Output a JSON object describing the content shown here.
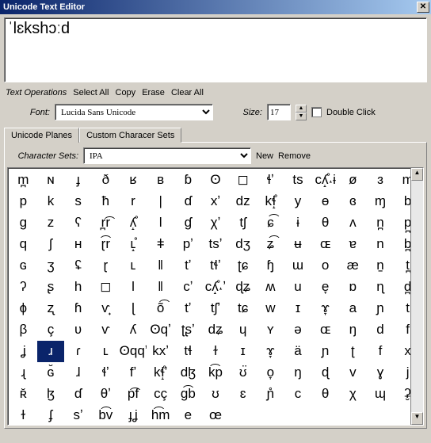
{
  "window": {
    "title": "Unicode Text Editor"
  },
  "editor": {
    "text": "ˈlɛkshɔːd"
  },
  "ops": {
    "label": "Text Operations",
    "select_all": "Select All",
    "copy": "Copy",
    "erase": "Erase",
    "clear_all": "Clear All"
  },
  "font": {
    "label": "Font:",
    "value": "Lucida Sans Unicode",
    "size_label": "Size:",
    "size_value": "17",
    "double_click": "Double Click"
  },
  "tabs": {
    "planes": "Unicode Planes",
    "custom": "Custom Characer Sets"
  },
  "charset": {
    "label": "Character Sets:",
    "value": "IPA",
    "new": "New",
    "remove": "Remove"
  },
  "grid": {
    "selected_index": 121,
    "cells": [
      "m̪",
      "ɴ",
      "ɟ",
      "ð",
      "ʁ",
      "ʙ",
      "ɓ",
      "ʘ",
      "◻",
      "ɬʼ",
      "ts",
      "cʎ̝̊˔ɨ",
      "ø",
      "ɜ",
      "m",
      "p",
      "k",
      "s",
      "ħ",
      "r",
      "|",
      "ɗ",
      "xʼ",
      "dz",
      "kɬ̝̊",
      "y",
      "ɵ",
      "ɞ",
      "ɱ",
      "b",
      "g",
      "z",
      "ʕ",
      "r̪͡r",
      "ʎ̝̊",
      "ǀ",
      "ɠ",
      "χʼ",
      "tʃ",
      "ɕ͡",
      "ɨ",
      "θ",
      "ʌ",
      "n̪",
      "p̪",
      "q",
      "ʃ",
      "ʜ",
      "ɽ͡r",
      "ʟ̝̊",
      "ǂ",
      "pʼ",
      "tsʼ",
      "dʒ",
      "ʑ͡",
      "ʉ",
      "ɶ",
      "ɐ",
      "n",
      "b̪",
      "ɢ",
      "ʒ",
      "ʢ",
      "ɽ",
      "ʟ",
      "‖",
      "tʼ",
      "tɬʼ",
      "ʈɕ",
      "ɧ",
      "ɯ",
      "o",
      "æ",
      "n̠",
      "t̪",
      "ʔ",
      "ʂ",
      "h",
      "◻",
      "l",
      "ǁ",
      "cʼ",
      "cʎ̝̊˔ʼ",
      "ɖʑ",
      "ʍ",
      "u",
      "e̞",
      "ɒ",
      "ɳ",
      "d̪",
      "ɸ",
      "ʐ",
      "ɦ",
      "ⱱ̟",
      "ɭ",
      "õ͡",
      "tʼ",
      "tʃʼ",
      "tɕ",
      "w",
      "ɪ",
      "ɤ̞",
      "a",
      "ɲ",
      "t",
      "β",
      "ç",
      "ʋ",
      "ⱱ",
      "ʎ",
      "ʘqʼ",
      "ʈʂʼ",
      "dʑ",
      "ɥ",
      "ʏ",
      "ə",
      "ɶ",
      "ŋ",
      "d",
      "f",
      "ʝ",
      "ɹ",
      "ɾ",
      "ʟ",
      "ʘqqʼ",
      "kxʼ",
      "tɬ",
      "ɫ",
      "ɪ",
      "ɤ̞",
      "ä",
      "ɲ",
      "ʈ",
      "f",
      "x",
      "ɻ",
      "ɢ̆",
      "ɺ",
      "ɬʼ",
      "fʼ",
      "kɬ̝̊ʼ",
      "dɮ",
      "k͡p",
      "ʊ̈",
      "o̞",
      "ŋ",
      "ɖ",
      "v",
      "ɣ",
      "j",
      "ʀ̆",
      "ɮ",
      "ɗ",
      "θʼ",
      "p͡f",
      "cç",
      "ɡ͡b",
      "ʊ",
      "ɛ",
      "ɲ̊",
      "c",
      "θ",
      "χ",
      "ɰ",
      "ʡ̮",
      "ɫ",
      "ʄ",
      "sʼ",
      "b͡v",
      "ɟʝ",
      "h͡m",
      "e",
      "œ"
    ]
  }
}
